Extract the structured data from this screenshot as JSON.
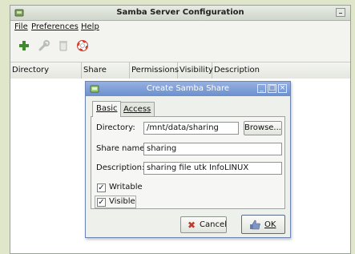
{
  "window": {
    "title": "Samba Server Configuration"
  },
  "menu": {
    "file": "File",
    "preferences": "Preferences",
    "help": "Help"
  },
  "toolbar": {
    "add_icon": "plus-icon",
    "properties_icon": "wrench-icon",
    "delete_icon": "trash-icon",
    "help_icon": "lifebuoy-icon"
  },
  "table": {
    "columns": [
      "Directory",
      "Share name",
      "Permissions",
      "Visibility",
      "Description"
    ]
  },
  "dialog": {
    "title": "Create Samba Share",
    "tabs": [
      "Basic",
      "Access"
    ],
    "directory_label": "Directory:",
    "directory_value": "/mnt/data/sharing",
    "browse_label": "Browse...",
    "share_name_label": "Share name:",
    "share_name_value": "sharing",
    "description_label": "Description:",
    "description_value": "sharing file utk InfoLINUX",
    "writable_label": "Writable",
    "writable_checked": true,
    "visible_label": "Visible",
    "visible_checked": true,
    "cancel_label": "Cancel",
    "ok_label": "OK"
  },
  "colors": {
    "desktop": "#dfe6c9",
    "dialog_title": "#7b9cd6",
    "cancel_x": "#c0392b"
  }
}
